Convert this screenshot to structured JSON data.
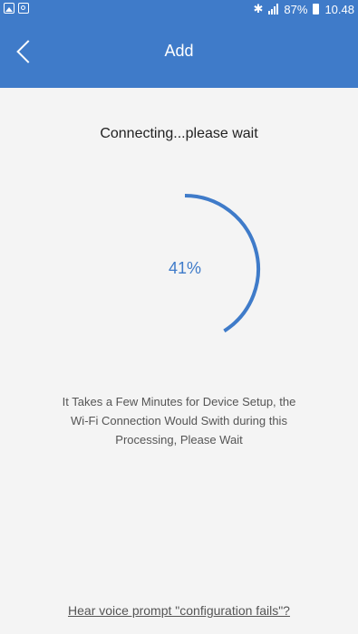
{
  "status_bar": {
    "icons": [
      "image-icon",
      "message-icon"
    ],
    "bluetooth": "✱",
    "battery_percent": "87%",
    "time": "10.48"
  },
  "header": {
    "title": "Add",
    "back_icon": "chevron-left-icon"
  },
  "main": {
    "connecting_text": "Connecting...please wait",
    "progress_percent": 41,
    "progress_label": "41%",
    "description_lines": [
      "It Takes a Few Minutes for Device Setup, the",
      "Wi-Fi Connection Would Swith during this",
      "Processing, Please Wait"
    ],
    "voice_link": "Hear voice prompt \"configuration fails\"?"
  },
  "colors": {
    "accent": "#3f7bc9",
    "background": "#f4f4f4"
  }
}
